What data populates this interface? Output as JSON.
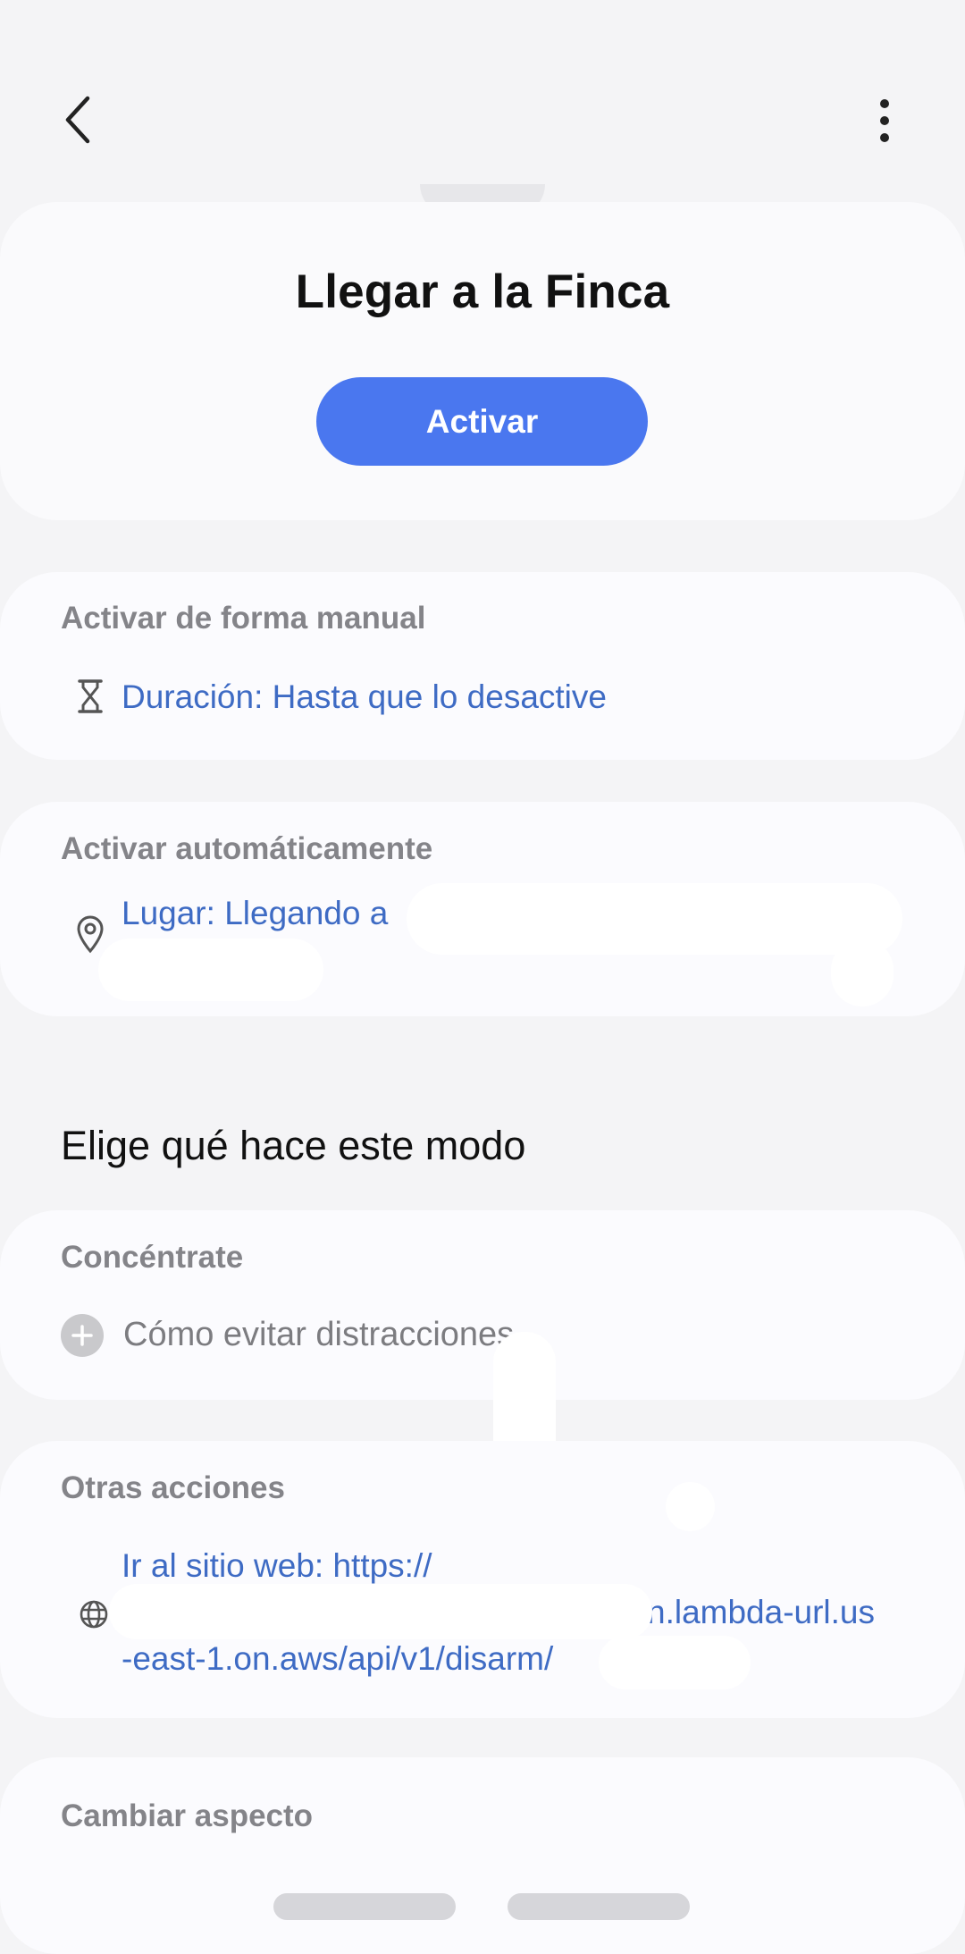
{
  "header": {
    "back_icon": "chevron-left-icon",
    "more_icon": "more-vertical-icon"
  },
  "mode": {
    "title": "Llegar a la Finca",
    "activate_button": "Activar"
  },
  "manual": {
    "label": "Activar de forma manual",
    "icon": "hourglass-icon",
    "duration": "Duración: Hasta que lo desactive"
  },
  "auto": {
    "label": "Activar automáticamente",
    "icon": "location-pin-icon",
    "place": "Lugar: Llegando a"
  },
  "choose": {
    "heading": "Elige qué hace este modo"
  },
  "focus": {
    "label": "Concéntrate",
    "icon": "plus-circle-icon",
    "item": "Cómo evitar distracciones"
  },
  "other": {
    "label": "Otras acciones",
    "icon": "globe-icon",
    "line1": "Ir al sitio web: https://",
    "line2": "n.lambda-url.us",
    "line3": "-east-1.on.aws/api/v1/disarm/"
  },
  "appearance": {
    "label": "Cambiar aspecto"
  },
  "colors": {
    "accent": "#4a77ef",
    "link": "#3e6bc4",
    "label_gray": "#848489",
    "background": "#f4f4f6",
    "card": "#fbfbfe"
  }
}
